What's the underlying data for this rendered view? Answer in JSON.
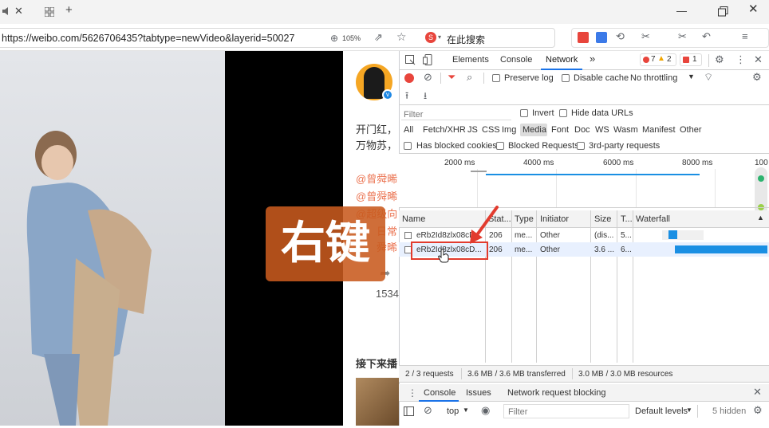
{
  "browser": {
    "tab_icon": "speaker-icon",
    "url": "https://weibo.com/5626706435?tabtype=newVideo&layerid=50027",
    "zoom": "105%",
    "search_label": "在此搜索"
  },
  "page": {
    "post_text_line1": "开门红，",
    "post_text_line2": "万物苏，",
    "mention1": "@曾舜晞",
    "mention2": "@曾舜晞",
    "mention3": "@超级向",
    "mention4": "日常",
    "mention5": "舜晞",
    "count": "1534",
    "section_title": "接下来播",
    "overlay_text": "右键"
  },
  "devtools": {
    "tabs": [
      "Elements",
      "Console",
      "Network"
    ],
    "more": "»",
    "errors": "7",
    "warnings": "2",
    "info": "1",
    "preserve_log": "Preserve log",
    "disable_cache": "Disable cache",
    "throttling": "No throttling",
    "filter_placeholder": "Filter",
    "invert": "Invert",
    "hide_data_urls": "Hide data URLs",
    "type_filters": [
      "All",
      "Fetch/XHR",
      "JS",
      "CSS",
      "Img",
      "Media",
      "Font",
      "Doc",
      "WS",
      "Wasm",
      "Manifest",
      "Other"
    ],
    "blocked_cookies": "Has blocked cookies",
    "blocked_requests": "Blocked Requests",
    "third_party": "3rd-party requests",
    "timeline_ticks": [
      "2000 ms",
      "4000 ms",
      "6000 ms",
      "8000 ms",
      "100"
    ],
    "columns": [
      "Name",
      "Stat...",
      "Type",
      "Initiator",
      "Size",
      "T...",
      "Waterfall"
    ],
    "rows": [
      {
        "name": "eRb2Id8zlx08cD...",
        "status": "206",
        "type": "me...",
        "initiator": "Other",
        "size": "(dis...",
        "time": "5..."
      },
      {
        "name": "eRb2Id8zlx08cD...",
        "status": "206",
        "type": "me...",
        "initiator": "Other",
        "size": "3.6 ...",
        "time": "6..."
      }
    ],
    "status_requests": "2 / 3 requests",
    "status_transferred": "3.6 MB / 3.6 MB transferred",
    "status_resources": "3.0 MB / 3.0 MB resources",
    "drawer_tabs": [
      "Console",
      "Issues",
      "Network request blocking"
    ],
    "console_context": "top",
    "console_filter": "Filter",
    "default_levels": "Default levels",
    "hidden": "5 hidden"
  }
}
